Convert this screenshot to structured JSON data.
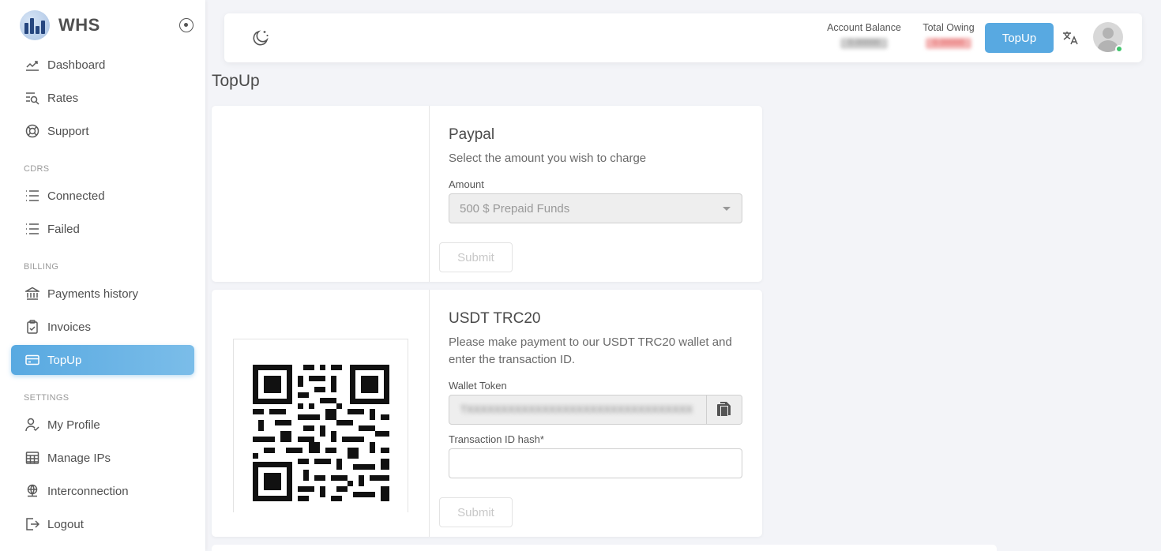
{
  "brand": {
    "name": "WHS"
  },
  "sidebar": {
    "items_main": [
      {
        "label": "Dashboard",
        "icon": "chart-line-icon"
      },
      {
        "label": "Rates",
        "icon": "list-search-icon"
      },
      {
        "label": "Support",
        "icon": "lifebuoy-icon"
      }
    ],
    "section_cdrs": "CDRS",
    "items_cdrs": [
      {
        "label": "Connected",
        "icon": "list-icon"
      },
      {
        "label": "Failed",
        "icon": "list-icon"
      }
    ],
    "section_billing": "BILLING",
    "items_billing": [
      {
        "label": "Payments history",
        "icon": "bank-icon"
      },
      {
        "label": "Invoices",
        "icon": "clipboard-icon"
      },
      {
        "label": "TopUp",
        "icon": "credit-card-icon",
        "active": true
      }
    ],
    "section_settings": "SETTINGS",
    "items_settings": [
      {
        "label": "My Profile",
        "icon": "user-check-icon"
      },
      {
        "label": "Manage IPs",
        "icon": "table-icon"
      },
      {
        "label": "Interconnection",
        "icon": "network-icon"
      },
      {
        "label": "Logout",
        "icon": "logout-icon"
      }
    ]
  },
  "header": {
    "account_balance_label": "Account Balance",
    "account_balance_value": "0.00000",
    "total_owing_label": "Total Owing",
    "total_owing_value": "0.00000",
    "topup_label": "TopUp"
  },
  "page": {
    "title": "TopUp"
  },
  "paypal": {
    "title": "Paypal",
    "subtitle": "Select the amount you wish to charge",
    "amount_label": "Amount",
    "amount_selected": "500 $ Prepaid Funds",
    "submit_label": "Submit"
  },
  "usdt": {
    "title": "USDT TRC20",
    "subtitle": "Please make payment to our USDT TRC20 wallet and enter the transaction ID.",
    "wallet_label": "Wallet Token",
    "wallet_value": "TXXXXXXXXXXXXXXXXXXXXXXXXXXXXXXXXX",
    "tx_label": "Transaction ID hash*",
    "tx_value": "",
    "submit_label": "Submit"
  },
  "colors": {
    "accent": "#58a9e1",
    "owing": "#e05555",
    "online": "#3fc46b"
  }
}
